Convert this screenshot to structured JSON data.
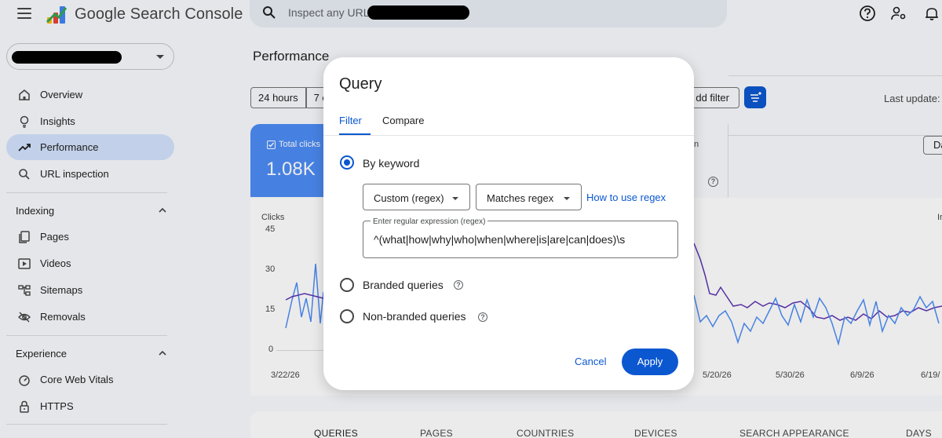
{
  "app": {
    "brand": "Google Search Console",
    "search_placeholder": "Inspect any URL i"
  },
  "sidebar": {
    "items": [
      {
        "label": "Overview",
        "icon": "home-icon"
      },
      {
        "label": "Insights",
        "icon": "lightbulb-icon"
      },
      {
        "label": "Performance",
        "icon": "trending-up-icon",
        "active": true
      },
      {
        "label": "URL inspection",
        "icon": "search-icon"
      }
    ],
    "sections": [
      {
        "title": "Indexing",
        "items": [
          {
            "label": "Pages",
            "icon": "pages-icon"
          },
          {
            "label": "Videos",
            "icon": "video-icon"
          },
          {
            "label": "Sitemaps",
            "icon": "sitemap-icon"
          },
          {
            "label": "Removals",
            "icon": "eye-off-icon"
          }
        ]
      },
      {
        "title": "Experience",
        "items": [
          {
            "label": "Core Web Vitals",
            "icon": "speed-gauge-icon"
          },
          {
            "label": "HTTPS",
            "icon": "lock-icon"
          }
        ]
      }
    ]
  },
  "main": {
    "title": "Performance",
    "chips": [
      "24 hours",
      "7 c"
    ],
    "add_filter": "dd filter",
    "last_update": "Last update: ",
    "date_btn": "Da",
    "clicks_card": {
      "label": "Total clicks",
      "value": "1.08K"
    },
    "position_card_label": "n",
    "chart": {
      "y_title": "Clicks",
      "y_ticks": [
        "45",
        "30",
        "15",
        "0"
      ],
      "x_ticks": [
        "3/22/26",
        "5/20/26",
        "5/30/26",
        "6/9/26",
        "6/19/"
      ],
      "right_label": "Ir"
    },
    "bottom_tabs": [
      "QUERIES",
      "PAGES",
      "COUNTRIES",
      "DEVICES",
      "SEARCH APPEARANCE",
      "DAYS"
    ]
  },
  "dialog": {
    "title": "Query",
    "tabs": [
      "Filter",
      "Compare"
    ],
    "options": {
      "by_keyword": "By keyword",
      "branded": "Branded queries",
      "non_branded": "Non-branded queries"
    },
    "type_select": "Custom (regex)",
    "match_select": "Matches regex",
    "how_to_link": "How to use regex",
    "regex_label": "Enter regular expression (regex)",
    "regex_value": "^(what|how|why|who|when|where|is|are|can|does)\\s",
    "cancel": "Cancel",
    "apply": "Apply",
    "help_glyph": "?"
  },
  "colors": {
    "primary": "#0b57d0",
    "clicks_series": "#4c8df6",
    "impressions_series": "#5e35b1"
  }
}
